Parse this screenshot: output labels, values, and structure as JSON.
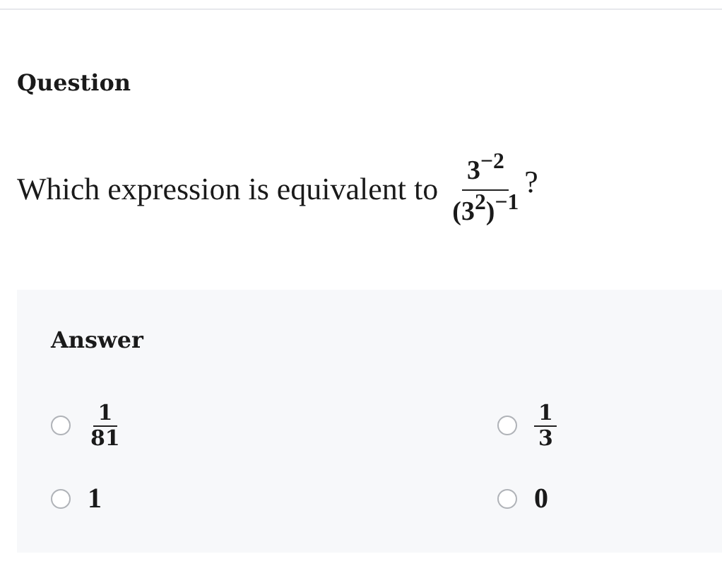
{
  "question": {
    "heading": "Question",
    "text": "Which expression is equivalent to",
    "expression": {
      "numerator": "3$^{−2}$",
      "denominator": "(3$^{2}$)$^{−1}$"
    },
    "end": "?"
  },
  "answer": {
    "heading": "Answer",
    "options": [
      {
        "kind": "fraction",
        "numerator": "1",
        "denominator": "81",
        "selected": false
      },
      {
        "kind": "fraction",
        "numerator": "1",
        "denominator": "3",
        "selected": false
      },
      {
        "kind": "number",
        "text": "1",
        "selected": false
      },
      {
        "kind": "number",
        "text": "0",
        "selected": false
      }
    ]
  }
}
